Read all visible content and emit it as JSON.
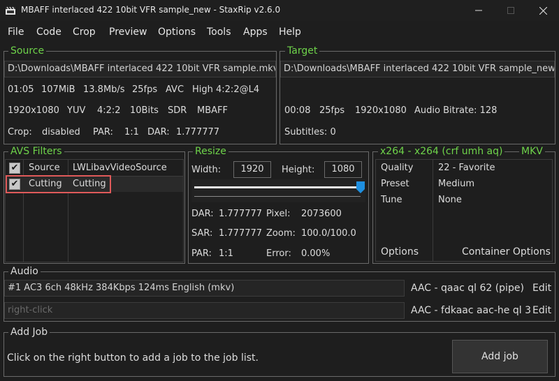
{
  "window": {
    "title": "MBAFF interlaced 422 10bit VFR sample_new - StaxRip v2.6.0"
  },
  "menu": [
    "File",
    "Code",
    "Crop",
    "Preview",
    "Options",
    "Tools",
    "Apps",
    "Help"
  ],
  "source": {
    "label": "Source",
    "path": "D:\\Downloads\\MBAFF interlaced 422 10bit VFR sample.mkv",
    "line1": [
      "01:05",
      "107MiB",
      "13.8Mb/s",
      "25fps",
      "AVC",
      "High 4:2:2@L4"
    ],
    "line2": [
      "1920x1080",
      "YUV",
      "4:2:2",
      "10Bits",
      "SDR",
      "MBAFF"
    ],
    "crop_label": "Crop:",
    "crop_value": "disabled",
    "par_label": "PAR:",
    "par_value": "1:1",
    "dar_label": "DAR:",
    "dar_value": "1.777777"
  },
  "target": {
    "label": "Target",
    "path": "D:\\Downloads\\MBAFF interlaced 422 10bit VFR sample_new",
    "info": [
      "00:08",
      "25fps",
      "1920x1080",
      "Audio Bitrate: 128"
    ],
    "subtitles": "Subtitles: 0"
  },
  "filters": {
    "label": "AVS Filters",
    "rows": [
      {
        "category": "Source",
        "name": "LWLibavVideoSource",
        "checked": true
      },
      {
        "category": "Cutting",
        "name": "Cutting",
        "checked": true
      }
    ]
  },
  "resize": {
    "label": "Resize",
    "width_label": "Width:",
    "width": "1920",
    "height_label": "Height:",
    "height": "1080",
    "dar_label": "DAR:",
    "dar": "1.777777",
    "pixel_label": "Pixel:",
    "pixel": "2073600",
    "sar_label": "SAR:",
    "sar": "1.777777",
    "zoom_label": "Zoom:",
    "zoom": "100.0/100.0",
    "par_label": "PAR:",
    "par": "1:1",
    "error_label": "Error:",
    "error": "0.00%",
    "slider_level": 1.0
  },
  "encoder": {
    "label": "x264 - x264 (crf umh aq)",
    "container": "MKV",
    "rows": [
      {
        "key": "Quality",
        "value": "22 - Favorite"
      },
      {
        "key": "Preset",
        "value": "Medium"
      },
      {
        "key": "Tune",
        "value": "None"
      }
    ],
    "options_link": "Options",
    "container_options_link": "Container Options"
  },
  "audio": {
    "label": "Audio",
    "tracks": [
      {
        "value": "#1 AC3 6ch 48kHz 384Kbps 124ms English (mkv)",
        "profile": "AAC - qaac ql 62 (pipe)",
        "edit": "Edit"
      },
      {
        "value": "right-click",
        "profile": "AAC - fdkaac aac-he ql 3",
        "edit": "Edit"
      }
    ]
  },
  "add_job": {
    "label": "Add Job",
    "hint": "Click on the right button to add a job to the job list.",
    "button": "Add job"
  },
  "colors": {
    "accent": "#6ed34a",
    "highlight": "#e05a5a",
    "slider": "#1e8fe0"
  }
}
